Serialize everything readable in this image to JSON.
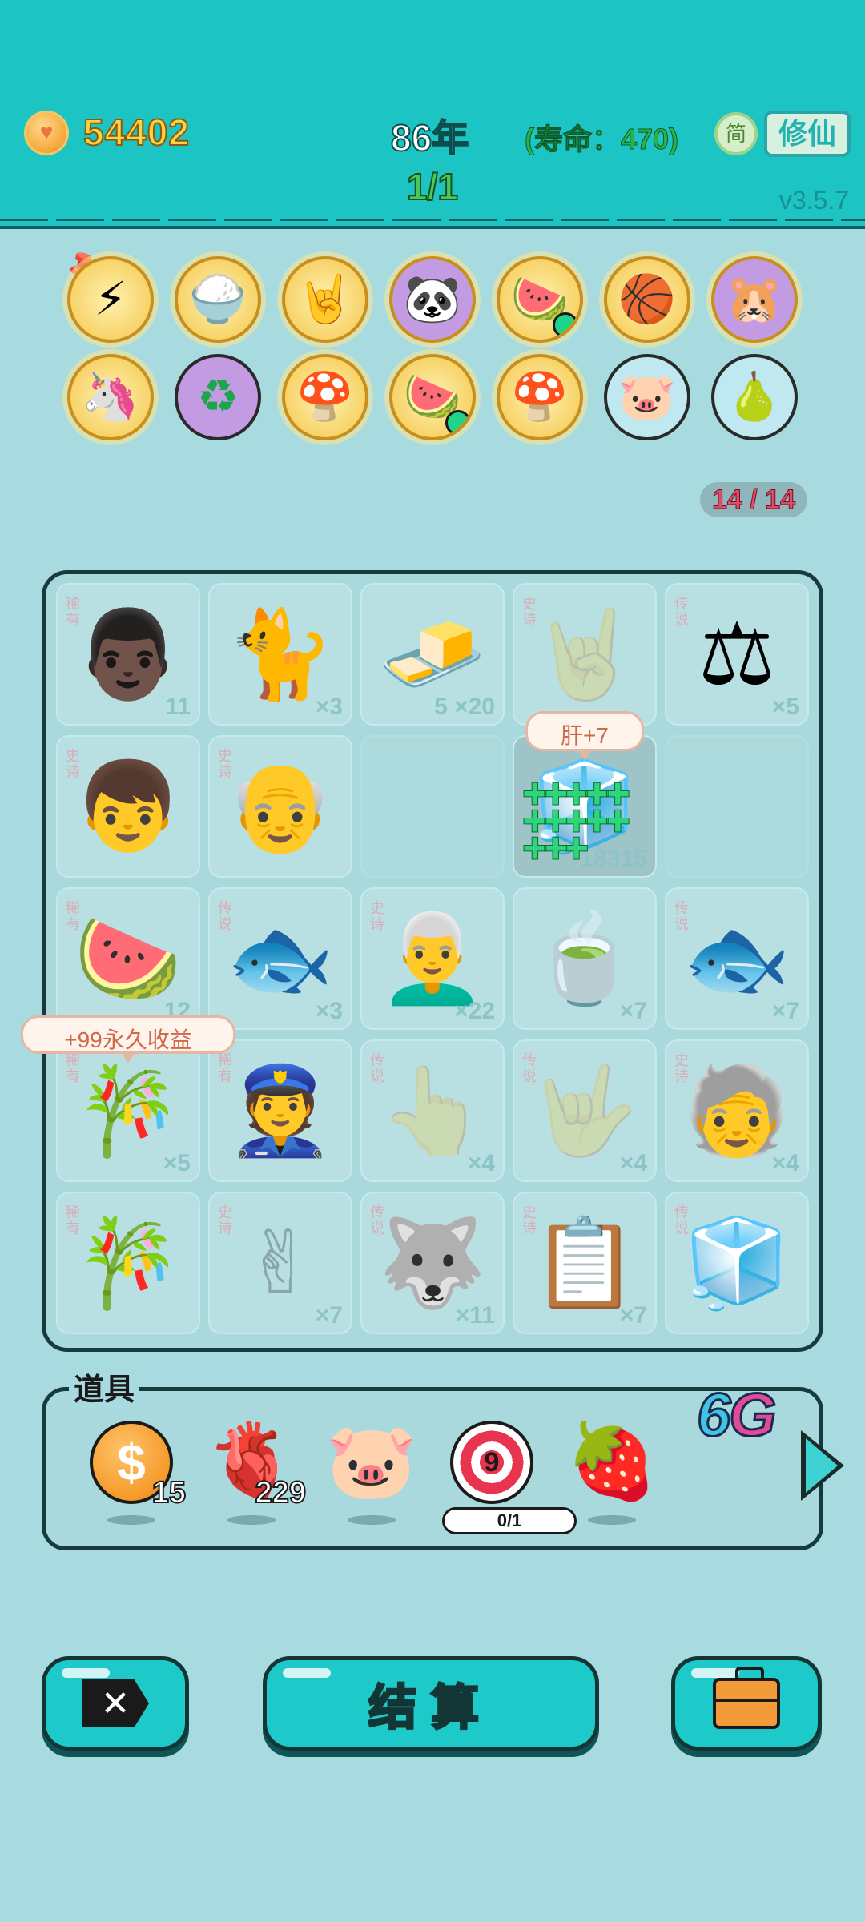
{
  "header": {
    "coins": "54402",
    "year": "86年",
    "lifespan": "(寿命：470)",
    "simplified_label": "简",
    "mode_button": "修仙",
    "stage": "1/1",
    "version": "v3.5.7"
  },
  "buffs": {
    "row1": [
      "⚡",
      "🍚",
      "🤘",
      "🐼",
      "🍉",
      "🏀",
      "🐹"
    ],
    "row2": [
      "🦄",
      "♻",
      "🍄",
      "🍉",
      "🍄",
      "🐷",
      "🍐"
    ]
  },
  "slots": "14 / 14",
  "grid": [
    [
      {
        "tag": "稀有",
        "item": "👨🏿",
        "count": "11"
      },
      {
        "tag": "",
        "item": "🐈",
        "count": "×3"
      },
      {
        "tag": "",
        "item": "🧈",
        "count": "5     ×20"
      },
      {
        "tag": "史诗",
        "item": "🤘",
        "count": "",
        "faint": true
      },
      {
        "tag": "传说",
        "item": "⚖",
        "count": "×5"
      }
    ],
    [
      {
        "tag": "史诗",
        "item": "👦",
        "count": ""
      },
      {
        "tag": "史诗",
        "item": "👴",
        "count": ""
      },
      {
        "tag": "",
        "item": "",
        "count": "",
        "empty": true
      },
      {
        "tag": "",
        "item": "🧊",
        "count": "18315",
        "active": true
      },
      {
        "tag": "",
        "item": "",
        "count": "",
        "empty": true
      }
    ],
    [
      {
        "tag": "稀有",
        "item": "🍉",
        "count": "12"
      },
      {
        "tag": "传说",
        "item": "🐟",
        "count": "×3"
      },
      {
        "tag": "史诗",
        "item": "👨‍🦳",
        "count": "×22"
      },
      {
        "tag": "",
        "item": "🍵",
        "count": "×7"
      },
      {
        "tag": "传说",
        "item": "🐟",
        "count": "×7"
      }
    ],
    [
      {
        "tag": "稀有",
        "item": "🎋",
        "count": "×5"
      },
      {
        "tag": "稀有",
        "item": "👮",
        "count": ""
      },
      {
        "tag": "传说",
        "item": "👆",
        "count": "×4",
        "faint": true
      },
      {
        "tag": "传说",
        "item": "🤟",
        "count": "×4",
        "faint": true
      },
      {
        "tag": "史诗",
        "item": "🧓",
        "count": "×4"
      }
    ],
    [
      {
        "tag": "稀有",
        "item": "🎋",
        "count": ""
      },
      {
        "tag": "史诗",
        "item": "✌",
        "count": "×7",
        "faint": true
      },
      {
        "tag": "传说",
        "item": "🐺",
        "count": "×11"
      },
      {
        "tag": "史诗",
        "item": "📋",
        "count": "×7"
      },
      {
        "tag": "传说",
        "item": "🧊",
        "count": ""
      }
    ]
  ],
  "popups": {
    "liver": "肝+7",
    "permanent": "+99永久收益"
  },
  "tools": {
    "title": "道具",
    "items": [
      {
        "icon": "$",
        "count": "15"
      },
      {
        "icon": "🫀",
        "count": "229"
      },
      {
        "icon": "🐷",
        "count": ""
      },
      {
        "icon": "9",
        "count": ""
      },
      {
        "icon": "🍓",
        "count": ""
      }
    ],
    "target_progress": "0/1",
    "signal_prefix": "6",
    "signal_suffix": "G"
  },
  "buttons": {
    "quit": "✕",
    "settle": "结算"
  }
}
